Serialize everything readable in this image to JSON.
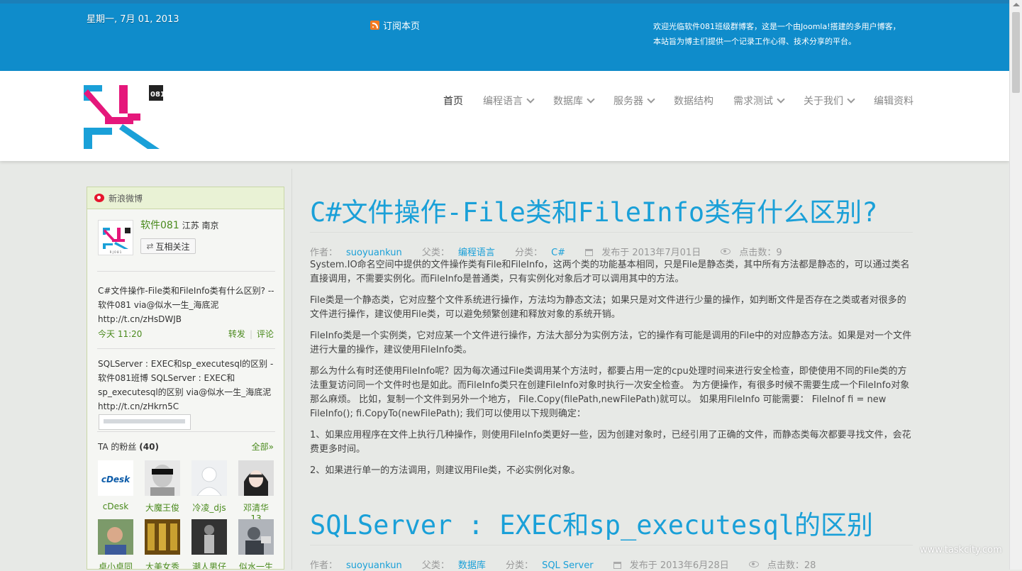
{
  "topbar": {
    "date": "星期一, 7月 01, 2013",
    "rss_label": "订阅本页",
    "welcome_line1": "欢迎光临软件081班级群博客，这是一个由Joomla!搭建的多用户博客，",
    "welcome_line2": "本站旨为博主们提供一个记录工作心得、技术分享的平台。"
  },
  "logo": {
    "text": "081"
  },
  "nav": {
    "items": [
      {
        "label": "首页",
        "active": true,
        "dropdown": false
      },
      {
        "label": "编程语言",
        "dropdown": true
      },
      {
        "label": "数据库",
        "dropdown": true
      },
      {
        "label": "服务器",
        "dropdown": true
      },
      {
        "label": "数据结构",
        "dropdown": false
      },
      {
        "label": "需求测试",
        "dropdown": true
      },
      {
        "label": "关于我们",
        "dropdown": true
      },
      {
        "label": "编辑资料",
        "dropdown": false
      }
    ]
  },
  "weibo": {
    "title": "新浪微博",
    "profile_name": "软件081",
    "location": "江苏 南京",
    "follow_label": "互相关注",
    "avatar_caption": "R J 0 8 1",
    "posts": [
      {
        "text": "C#文件操作-File类和FileInfo类有什么区别? -- 软件081 via@似水一生_海底泥 http://t.cn/zHsDWJB",
        "time": "今天 11:20",
        "forward": "转发",
        "comment": "评论"
      },
      {
        "text": "SQLServer : EXEC和sp_executesql的区别 - 软件081班博 SQLServer : EXEC和sp_executesql的区别 via@似水一生_海底泥 http://t.cn/zHkrn5C"
      }
    ],
    "fans_label": "TA 的粉丝",
    "fans_count": "(40)",
    "all_label": "全部»",
    "fans": [
      "cDesk",
      "大魔王俊",
      "冷凌_djs",
      "邓清华13",
      "卓小卓同",
      "大美女秀",
      "潮人男仔",
      "似水一生"
    ]
  },
  "articles": [
    {
      "title": "C#文件操作-File类和FileInfo类有什么区别?",
      "author_label": "作者：",
      "author": "suoyuankun",
      "parent_label": "父类：",
      "parent": "编程语言",
      "category_label": "分类：",
      "category": "C#",
      "published": "发布于 2013年7月01日",
      "hits": "点击数：9",
      "paragraphs": [
        "System.IO命名空间中提供的文件操作类有File和FileInfo，这两个类的功能基本相同，只是File是静态类，其中所有方法都是静态的，可以通过类名直接调用，不需要实例化。而FileInfo是普通类，只有实例化对象后才可以调用其中的方法。",
        "File类是一个静态类，它对应整个文件系统进行操作，方法均为静态文法；如果只是对文件进行少量的操作，如判断文件是否存在之类或者对很多的文件进行操作，建议使用File类，可以避免频繁创建和释放对象的系统开销。",
        "FileInfo类是一个实例类，它对应某一个文件进行操作，方法大部分为实例方法，它的操作有可能是调用的File中的对应静态方法。如果是对一个文件进行大量的操作，建议使用FileInfo类。",
        "那么为什么有时还使用FileInfo呢？因为每次通过File类调用某个方法时，都要占用一定的cpu处理时间来进行安全检查，即使使用不同的File类的方法重复访问同一个文件时也是如此。而FileInfo类只在创建FileInfo对象时执行一次安全检查。 为方便操作，有很多时候不需要生成一个FileInfo对象那么麻烦。 比如，复制一个文件到另外一个地方， File.Copy(filePath,newFilePath)就可以。 如果用FileInfo 可能需要： FileInof fi = new FileInfo(); fi.CopyTo(newFilePath); 我们可以使用以下规则确定：",
        "1、如果应用程序在文件上执行几种操作，则使用FileInfo类更好一些，因为创建对象时，已经引用了正确的文件，而静态类每次都要寻找文件，会花费更多时间。",
        "2、如果进行单一的方法调用，则建议用File类，不必实例化对象。"
      ]
    },
    {
      "title": "SQLServer : EXEC和sp_executesql的区别",
      "author_label": "作者：",
      "author": "suoyuankun",
      "parent_label": "父类：",
      "parent": "数据库",
      "category_label": "分类：",
      "category": "SQL Server",
      "published": "发布于 2013年6月28日",
      "hits": "点击数：28"
    }
  ],
  "watermark": "www.taskcity.com",
  "colors": {
    "topbar": "#0f8ccb",
    "link": "#1aa0d8",
    "weibo_green": "#4a8a1d",
    "logo_pink": "#e5177b",
    "logo_blue": "#1aa0d8"
  }
}
